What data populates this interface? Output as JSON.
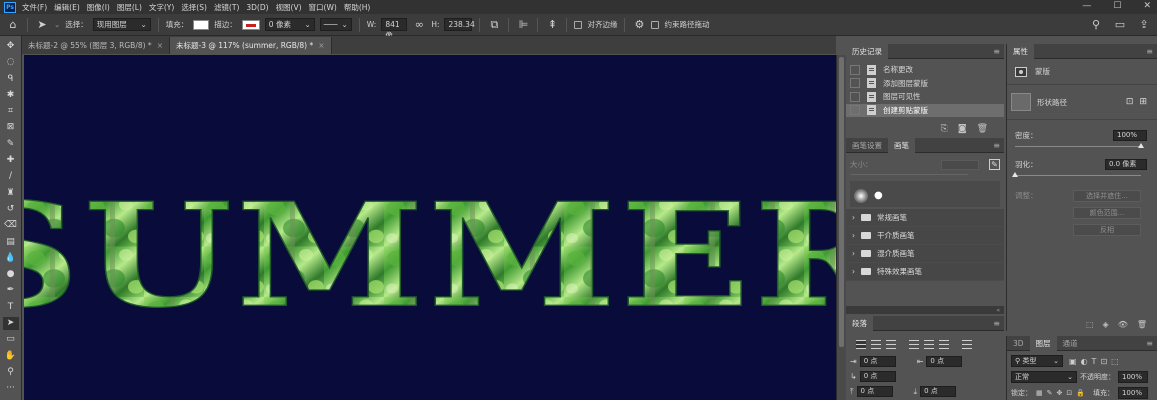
{
  "app": {
    "logo": "Ps"
  },
  "menu": [
    "文件(F)",
    "编辑(E)",
    "图像(I)",
    "图层(L)",
    "文字(Y)",
    "选择(S)",
    "滤镜(T)",
    "3D(D)",
    "视图(V)",
    "窗口(W)",
    "帮助(H)"
  ],
  "window_controls": {
    "minimize": "—",
    "maximize": "☐",
    "close": "✕"
  },
  "options": {
    "select_label": "选择：",
    "select_value": "现用图层",
    "fill_label": "填充：",
    "stroke_label": "描边：",
    "stroke_width": "0 像素",
    "w_label": "W:",
    "w_value": "841 像",
    "h_label": "H:",
    "h_value": "238.34",
    "align_edges": "对齐边缘",
    "constrain_path": "约束路径拖动"
  },
  "tabs": [
    {
      "label": "未标题-2 @ 55% (图层 3, RGB/8) *",
      "close": "×"
    },
    {
      "label": "未标题-3 @ 117% (summer, RGB/8) *",
      "close": "×"
    }
  ],
  "canvas": {
    "text": "SUMMER",
    "background": "#090b3a"
  },
  "history": {
    "tab": "历史记录",
    "items": [
      "名称更改",
      "添加图层蒙版",
      "图层可见性",
      "创建剪贴蒙版"
    ],
    "selected_index": 3
  },
  "brush_panel": {
    "tabs": [
      "画笔设置",
      "画笔"
    ],
    "size_label": "大小：",
    "folders": [
      "常规画笔",
      "干介质画笔",
      "湿介质画笔",
      "特殊效果画笔"
    ]
  },
  "paragraph": {
    "tab": "段落",
    "indent_left": "0 点",
    "indent_right": "0 点",
    "indent_first": "0 点",
    "space_before": "0 点",
    "space_after": "0 点"
  },
  "properties": {
    "tab": "属性",
    "section": "蒙版",
    "item": "形状路径",
    "density_label": "密度：",
    "density_value": "100%",
    "feather_label": "羽化：",
    "feather_value": "0.0 像素",
    "adjust_label": "调整：",
    "buttons": [
      "选择并遮住...",
      "颜色范围...",
      "反相"
    ]
  },
  "layers": {
    "tabs": [
      "3D",
      "图层",
      "通道"
    ],
    "kind_label": "类型",
    "blend_mode": "正常",
    "opacity_label": "不透明度：",
    "opacity_value": "100%",
    "lock_label": "锁定：",
    "fill_label": "填充：",
    "fill_value": "100%"
  }
}
